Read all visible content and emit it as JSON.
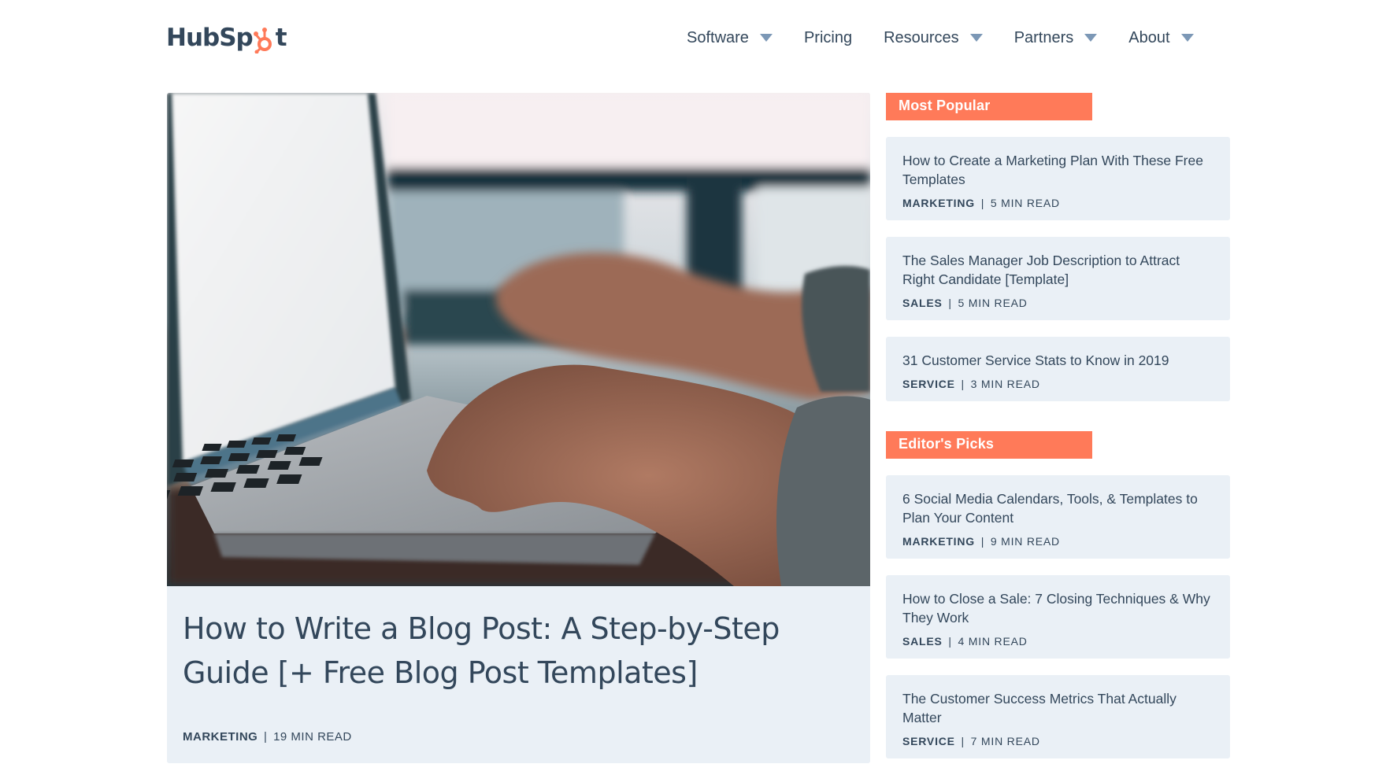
{
  "brand": {
    "name_left": "HubSp",
    "name_right": "t",
    "accent_color": "#ff7a59",
    "text_color": "#33475b",
    "card_bg": "#eaf0f6"
  },
  "nav": {
    "items": [
      {
        "label": "Software",
        "has_dropdown": true
      },
      {
        "label": "Pricing",
        "has_dropdown": false
      },
      {
        "label": "Resources",
        "has_dropdown": true
      },
      {
        "label": "Partners",
        "has_dropdown": true
      },
      {
        "label": "About",
        "has_dropdown": true
      }
    ]
  },
  "featured": {
    "title": "How to Write a Blog Post: A Step-by-Step Guide [+ Free Blog Post Templates]",
    "category": "MARKETING",
    "separator": "|",
    "read_time": "19 MIN READ",
    "image_alt": "hands-typing-on-laptop"
  },
  "sidebar": {
    "most_popular": {
      "label": "Most Popular",
      "posts": [
        {
          "title": "How to Create a Marketing Plan With These Free Templates",
          "category": "MARKETING",
          "read_time": "5 MIN READ"
        },
        {
          "title": "The Sales Manager Job Description to Attract Right Candidate [Template]",
          "category": "SALES",
          "read_time": "5 MIN READ"
        },
        {
          "title": "31 Customer Service Stats to Know in 2019",
          "category": "SERVICE",
          "read_time": "3 MIN READ"
        }
      ]
    },
    "editors_picks": {
      "label": "Editor's Picks",
      "posts": [
        {
          "title": "6 Social Media Calendars, Tools, & Templates to Plan Your Content",
          "category": "MARKETING",
          "read_time": "9 MIN READ"
        },
        {
          "title": "How to Close a Sale: 7 Closing Techniques & Why They Work",
          "category": "SALES",
          "read_time": "4 MIN READ"
        },
        {
          "title": "The Customer Success Metrics That Actually Matter",
          "category": "SERVICE",
          "read_time": "7 MIN READ"
        }
      ]
    },
    "separator": "|"
  }
}
